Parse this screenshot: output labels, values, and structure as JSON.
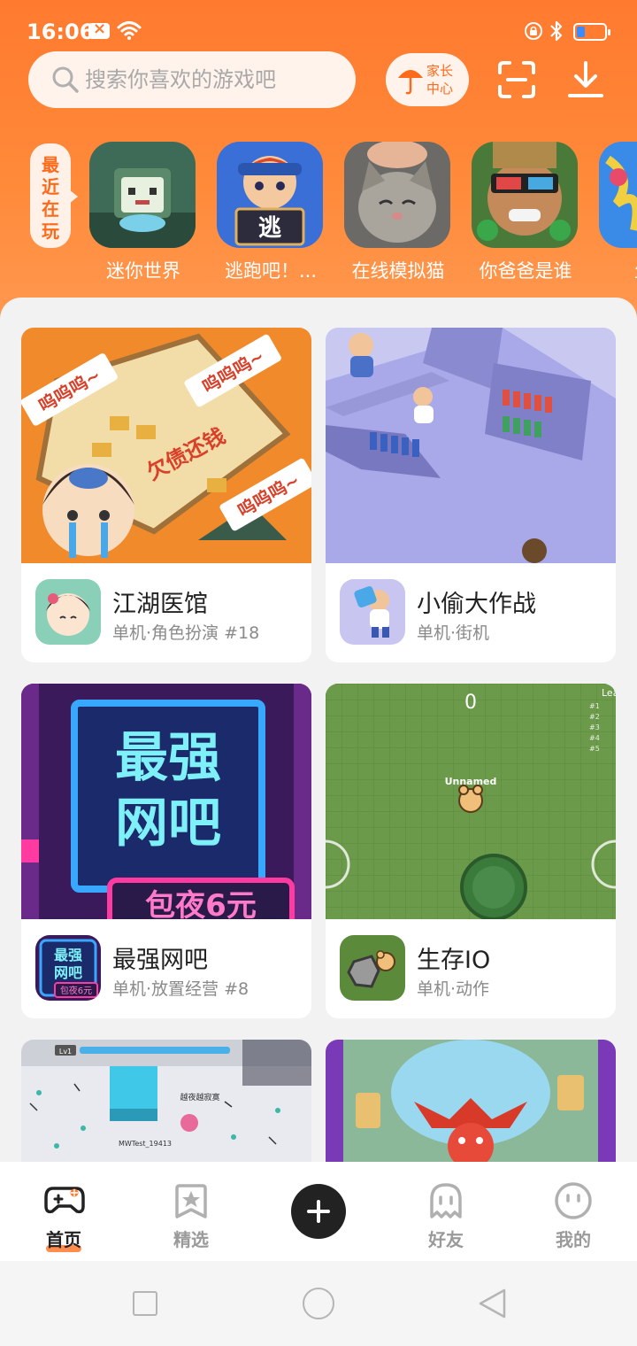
{
  "status_bar": {
    "time": "16:06",
    "battery_level": 0.3
  },
  "search": {
    "placeholder": "搜索你喜欢的游戏吧"
  },
  "parent_center": {
    "label_line1": "家长",
    "label_line2": "中心"
  },
  "recent": {
    "tag_chars": [
      "最",
      "近",
      "在",
      "玩"
    ],
    "items": [
      {
        "label": "迷你世界"
      },
      {
        "label": "逃跑吧！..."
      },
      {
        "label": "在线模拟猫"
      },
      {
        "label": "你爸爸是谁"
      },
      {
        "label": "生物"
      }
    ]
  },
  "cards": [
    {
      "title": "江湖医馆",
      "subtitle": "单机·角色扮演 #18",
      "banner_text_1": "呜呜呜~",
      "banner_text_2": "欠债还钱"
    },
    {
      "title": "小偷大作战",
      "subtitle": "单机·街机"
    },
    {
      "title": "最强网吧",
      "subtitle": "单机·放置经营 #8",
      "banner_text_1": "最强",
      "banner_text_2": "网吧",
      "banner_text_3": "包夜6元",
      "icon_text_1": "最强",
      "icon_text_2": "网吧",
      "icon_text_3": "包夜6元"
    },
    {
      "title": "生存IO",
      "subtitle": "单机·动作",
      "banner_score": "0",
      "banner_player": "Unnamed",
      "banner_board_title": "Lea"
    },
    {
      "title": "",
      "subtitle": "",
      "banner_level": "Lv1",
      "banner_player": "MWTest_19413",
      "banner_player2": "越夜越寂寞"
    },
    {
      "title": "",
      "subtitle": ""
    }
  ],
  "bottom_nav": [
    {
      "label": "首页",
      "active": true
    },
    {
      "label": "精选",
      "active": false
    },
    {
      "label": "好友",
      "active": false
    },
    {
      "label": "我的",
      "active": false
    }
  ],
  "colors": {
    "accent": "#ff7a2f",
    "header_gradient_top": "#ff7a2f",
    "text_primary": "#222222",
    "text_secondary": "#8a8a8a"
  }
}
